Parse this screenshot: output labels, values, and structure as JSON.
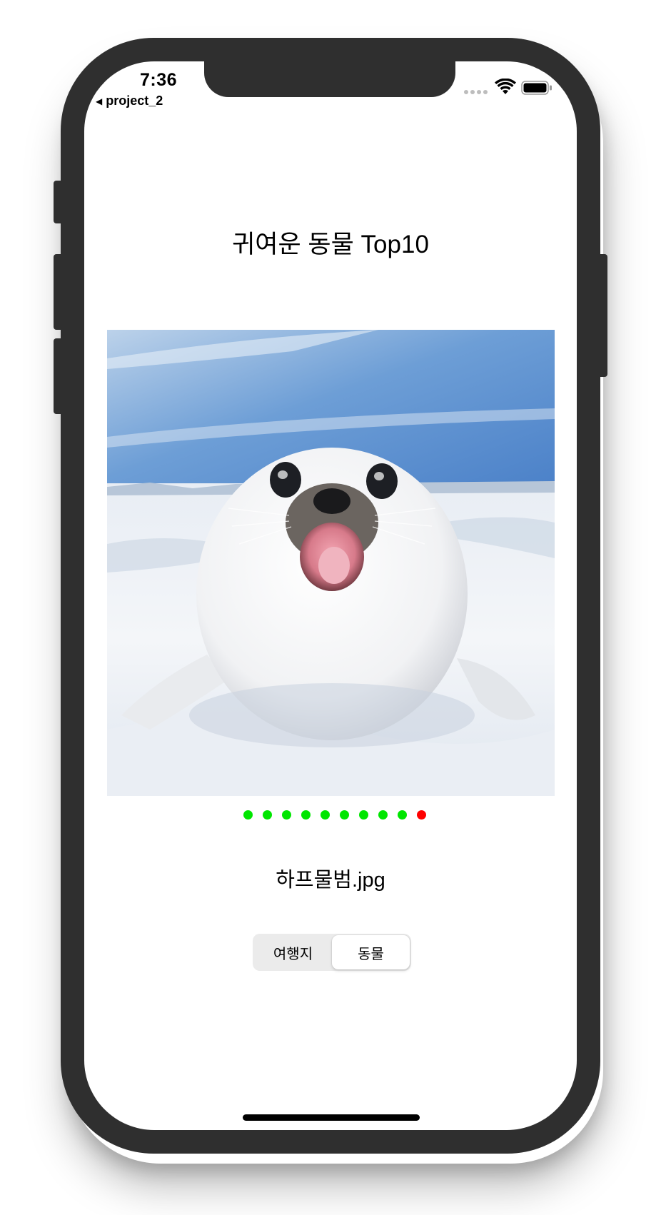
{
  "status_bar": {
    "time": "7:36",
    "back_app": "project_2"
  },
  "title": "귀여운 동물 Top10",
  "photo": {
    "subject": "harp seal pup on snow"
  },
  "page_indicator": {
    "count": 10,
    "current_index": 9,
    "active_color": "#ff0000",
    "inactive_color": "#00e600"
  },
  "filename": "하프물범.jpg",
  "segmented_control": {
    "options": [
      "여행지",
      "동물"
    ],
    "selected_index": 1
  },
  "colors": {
    "frame": "#2f2f2f"
  }
}
